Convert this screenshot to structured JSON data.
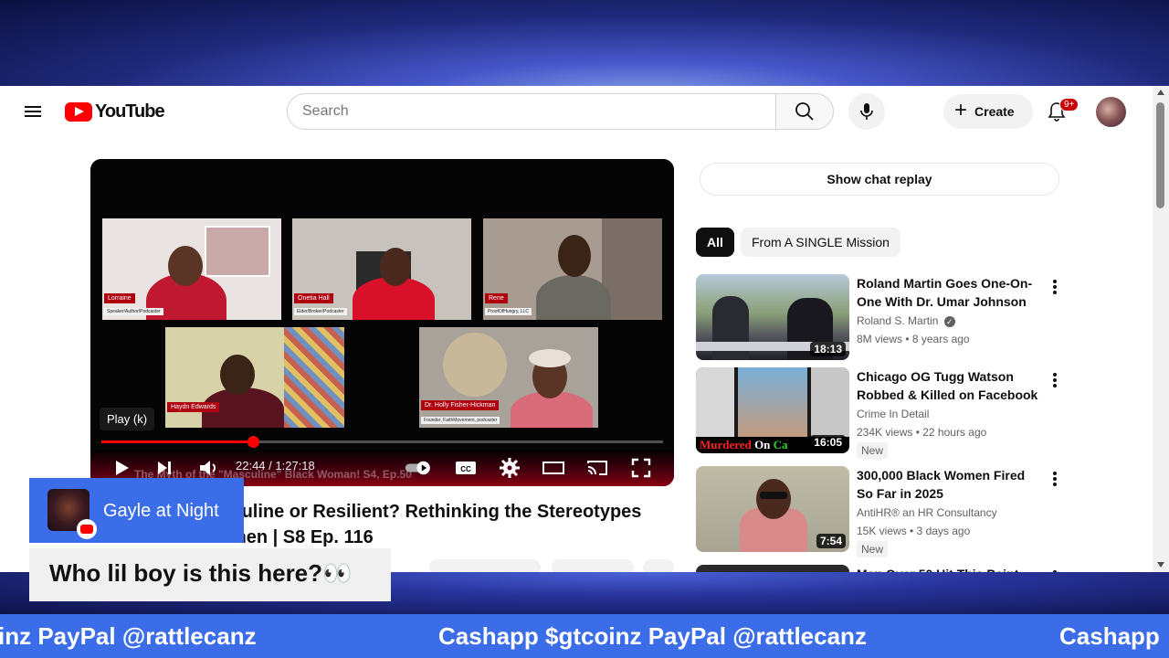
{
  "header": {
    "logo_text": "YouTube",
    "search_placeholder": "Search",
    "create_label": "Create",
    "notification_badge": "9+"
  },
  "player": {
    "tooltip": "Play (k)",
    "time_display": "22:44 / 1:27:18",
    "progress_fraction": 0.27,
    "subtitle_ghost": "The Myth of the \"Masculine\" Black Woman! S4, Ep.50",
    "participants": [
      {
        "name": "Lorraine",
        "role": "Speaker/Author/Podcaster"
      },
      {
        "name": "Onetia Hall",
        "role": "Elder/Broker/Podcaster"
      },
      {
        "name": "Rene",
        "role": "ProofOfHungry, LLC"
      },
      {
        "name": "Haydn Edwards",
        "role": ""
      },
      {
        "name": "Dr. Holly Fisher-Hickman",
        "role": "Founder, FaithMovement, podcaster"
      }
    ]
  },
  "video": {
    "title_line1": "Rethinking: Masculine or Resilient? Rethinking the Stereotypes",
    "title_line2": "About Black Women | S8 Ep. 116"
  },
  "sidebar": {
    "chat_replay": "Show chat replay",
    "chips": [
      "All",
      "From A SINGLE Mission"
    ],
    "recommendations": [
      {
        "title": "Roland Martin Goes One-On-One With Dr. Umar Johnson",
        "channel": "Roland S. Martin",
        "verified": true,
        "stats": "8M views • 8 years ago",
        "duration": "18:13",
        "new": ""
      },
      {
        "title": "Chicago OG Tugg Watson Robbed & Killed on Facebook …",
        "channel": "Crime In Detail",
        "verified": false,
        "stats": "234K views • 22 hours ago",
        "duration": "16:05",
        "new": "New"
      },
      {
        "title": "300,000 Black Women Fired So Far in 2025",
        "channel": "AntiHR® an HR Consultancy",
        "verified": false,
        "stats": "15K views • 3 days ago",
        "duration": "7:54",
        "new": "New"
      },
      {
        "title": "Men Over 50 Hit This Point",
        "channel": "",
        "verified": false,
        "stats": "",
        "duration": "",
        "new": ""
      }
    ]
  },
  "overlays": {
    "streamer_name": "Gayle at Night",
    "comment": "Who lil boy is this here?👀",
    "ticker_text": "Cashapp $gtcoinz PayPal @rattlecanz",
    "ticker_left_fragment": "inz PayPal @rattlecanz",
    "ticker_right_fragment": "Cashapp"
  },
  "colors": {
    "brand_red": "#ff0000",
    "overlay_blue": "#3c6de8"
  }
}
